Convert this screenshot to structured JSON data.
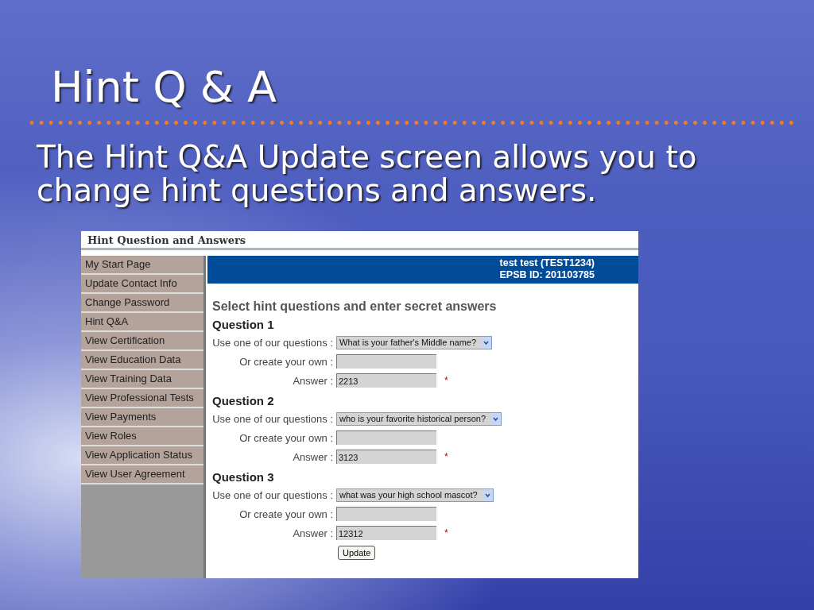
{
  "slide": {
    "title": "Hint Q & A",
    "body": "The Hint Q&A Update screen allows you to change hint questions and answers."
  },
  "screen": {
    "title": "Hint Question and Answers",
    "sidebar": {
      "items": [
        "My Start Page",
        "Update Contact Info",
        "Change Password",
        "Hint Q&A",
        "View Certification",
        "View Education Data",
        "View Training Data",
        "View Professional Tests",
        "View Payments",
        "View Roles",
        "View Application Status",
        "View User Agreement"
      ]
    },
    "user": {
      "name": "test test (TEST1234)",
      "id": "EPSB ID: 201103785"
    },
    "heading": "Select hint questions and enter secret answers",
    "questions": [
      {
        "title": "Question 1",
        "select_label": "Use one of our questions :",
        "selected_question": "What is your father's Middle name?",
        "own_label": "Or create your own :",
        "answer_label": "Answer :",
        "answer": "2213",
        "required_mark": "*"
      },
      {
        "title": "Question 2",
        "select_label": "Use one of our questions :",
        "selected_question": "who is your favorite historical person?",
        "own_label": "Or create your own :",
        "answer_label": "Answer :",
        "answer": "3123",
        "required_mark": "*"
      },
      {
        "title": "Question 3",
        "select_label": "Use one of our questions :",
        "selected_question": "what was your high school mascot?",
        "own_label": "Or create your own :",
        "answer_label": "Answer :",
        "answer": "12312",
        "required_mark": "*"
      }
    ],
    "submit": "Update"
  }
}
